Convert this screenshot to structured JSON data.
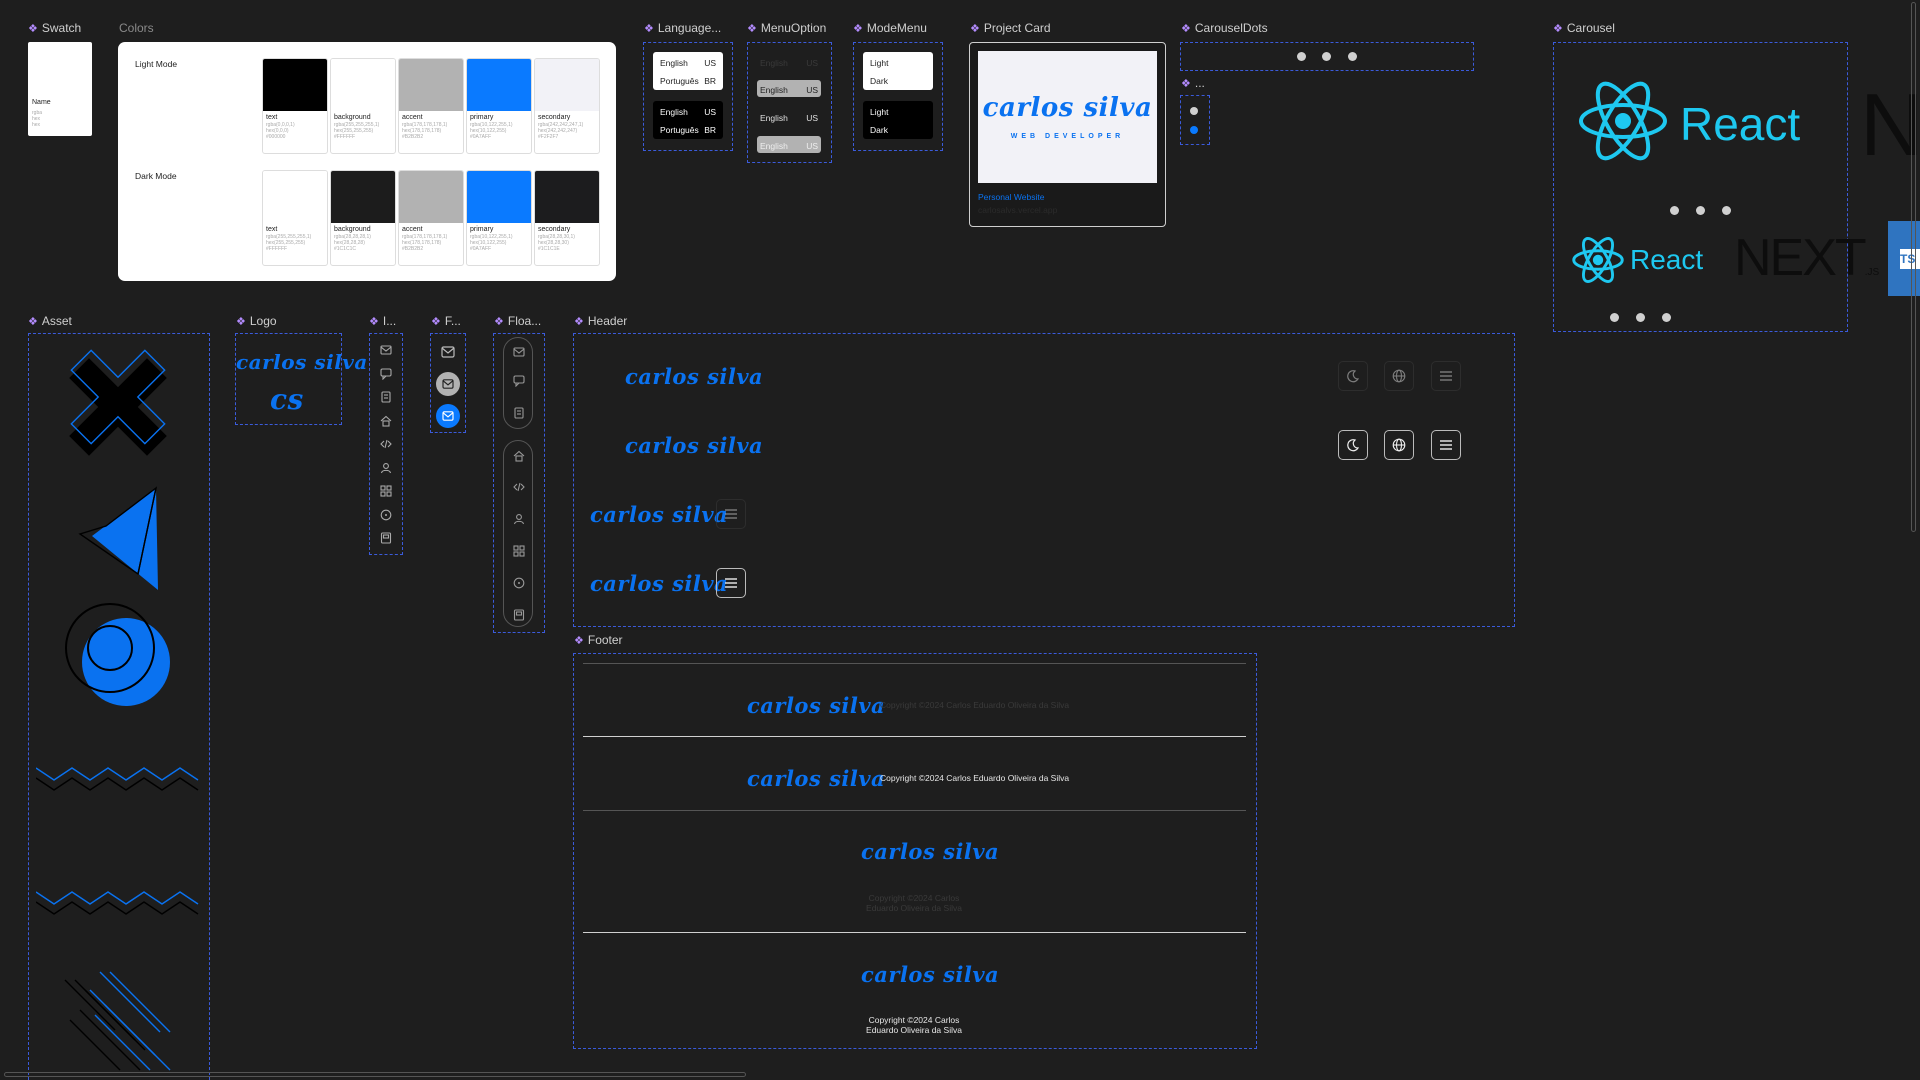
{
  "frames": {
    "swatch": "Swatch",
    "colors": "Colors",
    "language": "Language...",
    "menu_option": "MenuOption",
    "mode_menu": "ModeMenu",
    "project_card": "Project Card",
    "carousel_dots": "CarouselDots",
    "dots_small": "...",
    "carousel": "Carousel",
    "asset": "Asset",
    "logo": "Logo",
    "icons": "I...",
    "float_small": "F...",
    "floating": "Floa...",
    "header": "Header",
    "footer": "Footer"
  },
  "swatch_card": {
    "name": "Name",
    "lines": [
      "rgba",
      "hex",
      "hex"
    ]
  },
  "colors": {
    "light_title": "Light Mode",
    "dark_title": "Dark Mode",
    "light": [
      {
        "name": "text",
        "hex": "#000000",
        "v1": "rgba(0,0,0,1)",
        "v2": "hex(0,0,0)",
        "v3": "#000000"
      },
      {
        "name": "background",
        "hex": "#ffffff",
        "v1": "rgba(255,255,255,1)",
        "v2": "hex(255,255,255)",
        "v3": "#FFFFFF"
      },
      {
        "name": "accent",
        "hex": "#b2b2b2",
        "v1": "rgba(178,178,178,1)",
        "v2": "hex(178,178,178)",
        "v3": "#B2B2B2"
      },
      {
        "name": "primary",
        "hex": "#0a7aff",
        "v1": "rgba(10,122,255,1)",
        "v2": "hex(10,122,255)",
        "v3": "#0A7AFF"
      },
      {
        "name": "secondary",
        "hex": "#f2f2f7",
        "v1": "rgba(242,242,247,1)",
        "v2": "hex(242,242,247)",
        "v3": "#F2F2F7"
      }
    ],
    "dark": [
      {
        "name": "text",
        "hex": "#ffffff",
        "v1": "rgba(255,255,255,1)",
        "v2": "hex(255,255,255)",
        "v3": "#FFFFFF"
      },
      {
        "name": "background",
        "hex": "#1c1c1c",
        "v1": "rgba(28,28,28,1)",
        "v2": "hex(28,28,28)",
        "v3": "#1C1C1C"
      },
      {
        "name": "accent",
        "hex": "#b2b2b2",
        "v1": "rgba(178,178,178,1)",
        "v2": "hex(178,178,178)",
        "v3": "#B2B2B2"
      },
      {
        "name": "primary",
        "hex": "#0a7aff",
        "v1": "rgba(10,122,255,1)",
        "v2": "hex(10,122,255)",
        "v3": "#0A7AFF"
      },
      {
        "name": "secondary",
        "hex": "#1c1c1e",
        "v1": "rgba(28,28,30,1)",
        "v2": "hex(28,28,30)",
        "v3": "#1C1C1E"
      }
    ]
  },
  "language_menu": {
    "english": "English",
    "english_code": "US",
    "portuguese": "Português",
    "portuguese_code": "BR"
  },
  "menu_option": {
    "label": "English",
    "code": "US"
  },
  "mode_menu": {
    "light": "Light",
    "dark": "Dark"
  },
  "project_card": {
    "logo_text": "carlos silva",
    "logo_subtitle": "WEB DEVELOPER",
    "title": "Personal Website",
    "url": "carlosalvs.vercel.app"
  },
  "carousel": {
    "react_label": "React",
    "next_label": "NEXT",
    "next_suffix": ".JS",
    "ts_label": "TS",
    "react_color": "#1ec8f0"
  },
  "logo": {
    "text": "carlos silva",
    "mono": "cs"
  },
  "header": {
    "logo_text": "carlos silva"
  },
  "footer": {
    "logo_text": "carlos silva",
    "copyright": "Copyright ©2024 Carlos Eduardo Oliveira da Silva",
    "copyright_line1": "Copyright ©2024 Carlos",
    "copyright_line2": "Eduardo Oliveira da Silva"
  },
  "theme": {
    "brand_blue": "#0a72f0",
    "frame_dash": "#3b5bdb",
    "canvas": "#1e1e1e"
  }
}
